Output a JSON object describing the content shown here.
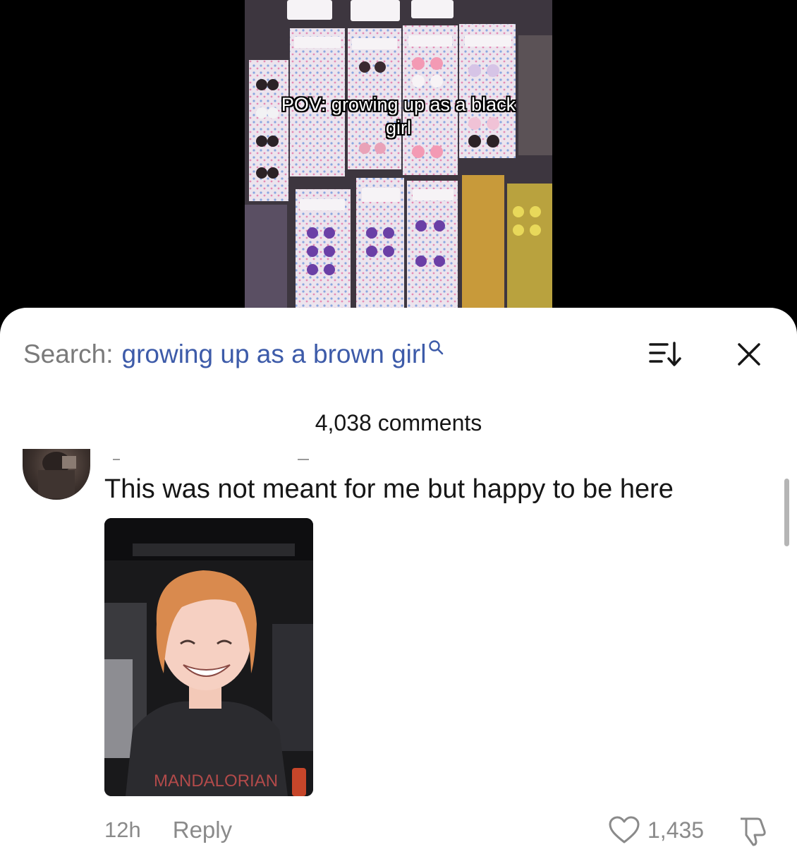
{
  "video": {
    "caption": "POV: growing up as a black girl"
  },
  "comments_panel": {
    "search_prefix": "Search:",
    "search_query": "growing up as a brown girl",
    "comment_count": "4,038 comments"
  },
  "comment": {
    "text": "This was not meant for me but happy to be here",
    "timestamp": "12h",
    "reply_label": "Reply",
    "like_count": "1,435"
  },
  "icons": {
    "search": "search-icon",
    "sort": "sort-icon",
    "close": "close-icon",
    "like": "heart-icon",
    "dislike": "thumbs-down-icon"
  },
  "colors": {
    "search_query": "#3d5ba9",
    "muted_text": "#8a8a8a",
    "sheet_background": "#ffffff",
    "video_background": "#000000"
  }
}
